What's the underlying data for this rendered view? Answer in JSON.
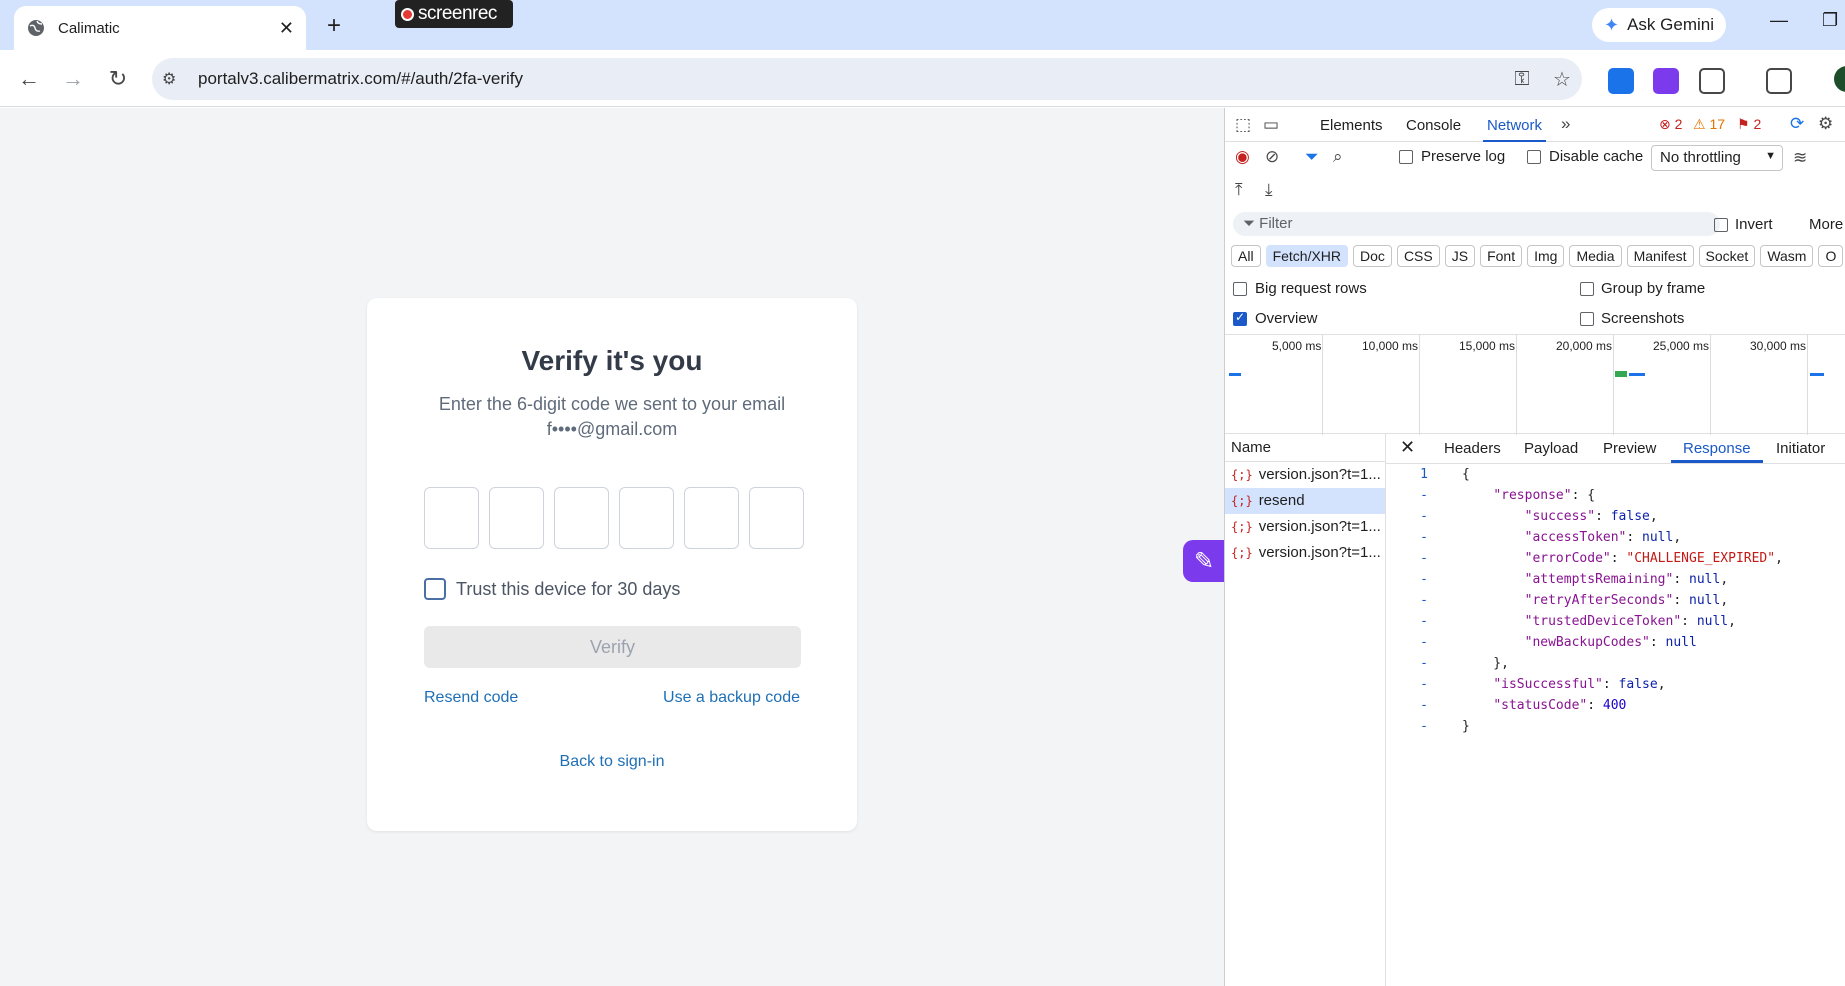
{
  "browser": {
    "tab_title": "Calimatic",
    "screenrec_label": "screenrec",
    "gemini_label": "Ask Gemini",
    "url": "portalv3.calibermatrix.com/#/auth/2fa-verify"
  },
  "page": {
    "title": "Verify it's you",
    "subtitle_line1": "Enter the 6-digit code we sent to your email",
    "subtitle_line2": "f••••@gmail.com",
    "code_digits": [
      "",
      "",
      "",
      "",
      "",
      ""
    ],
    "trust_label": "Trust this device for 30 days",
    "verify_label": "Verify",
    "resend_label": "Resend code",
    "backup_label": "Use a backup code",
    "back_label": "Back to sign-in"
  },
  "devtools": {
    "tabs": [
      "Elements",
      "Console",
      "Network"
    ],
    "active_tab": "Network",
    "errors": "2",
    "warnings": "17",
    "issues": "2",
    "preserve_log": "Preserve log",
    "disable_cache": "Disable cache",
    "throttling": "No throttling",
    "filter_placeholder": "Filter",
    "invert": "Invert",
    "more": "More",
    "types": [
      "All",
      "Fetch/XHR",
      "Doc",
      "CSS",
      "JS",
      "Font",
      "Img",
      "Media",
      "Manifest",
      "Socket",
      "Wasm",
      "O"
    ],
    "active_type": "Fetch/XHR",
    "big_rows": "Big request rows",
    "group_by_frame": "Group by frame",
    "overview": "Overview",
    "screenshots": "Screenshots",
    "timeline_ticks": [
      "5,000 ms",
      "10,000 ms",
      "15,000 ms",
      "20,000 ms",
      "25,000 ms",
      "30,000 ms"
    ],
    "name_header": "Name",
    "requests": [
      "version.json?t=1...",
      "resend",
      "version.json?t=1...",
      "version.json?t=1..."
    ],
    "selected_request": "resend",
    "detail_tabs": [
      "Headers",
      "Payload",
      "Preview",
      "Response",
      "Initiator"
    ],
    "active_detail_tab": "Response",
    "response_lines": [
      {
        "g": "1",
        "t": "{"
      },
      {
        "g": "-",
        "t": "    \"response\": {"
      },
      {
        "g": "-",
        "t": "        \"success\": false,"
      },
      {
        "g": "-",
        "t": "        \"accessToken\": null,"
      },
      {
        "g": "-",
        "t": "        \"errorCode\": \"CHALLENGE_EXPIRED\","
      },
      {
        "g": "-",
        "t": "        \"attemptsRemaining\": null,"
      },
      {
        "g": "-",
        "t": "        \"retryAfterSeconds\": null,"
      },
      {
        "g": "-",
        "t": "        \"trustedDeviceToken\": null,"
      },
      {
        "g": "-",
        "t": "        \"newBackupCodes\": null"
      },
      {
        "g": "-",
        "t": "    },"
      },
      {
        "g": "-",
        "t": "    \"isSuccessful\": false,"
      },
      {
        "g": "-",
        "t": "    \"statusCode\": 400"
      },
      {
        "g": "-",
        "t": "}"
      }
    ]
  },
  "colors": {
    "accent": "#1a59c7",
    "link": "#1e6fb5",
    "tabstrip": "#d3e3fd",
    "page_bg": "#f3f4f6"
  }
}
